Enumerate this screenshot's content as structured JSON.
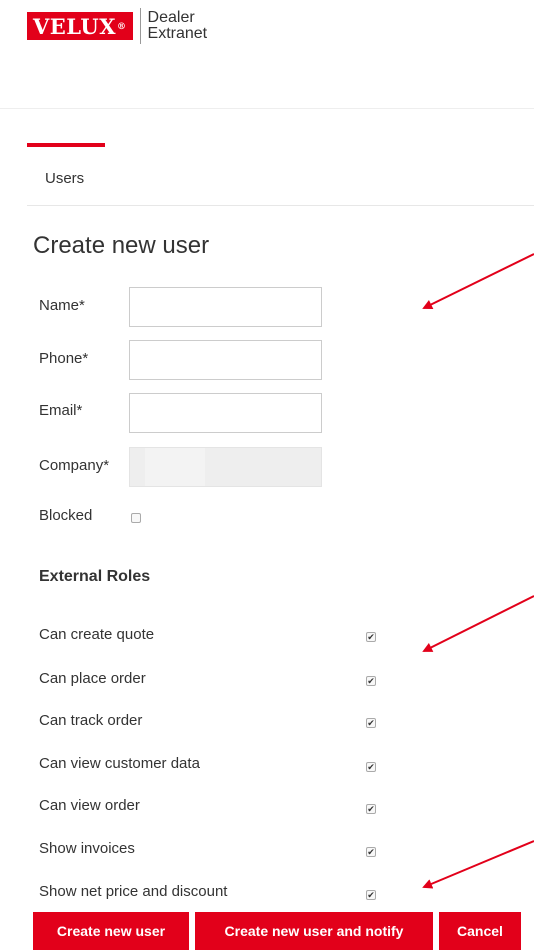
{
  "logo": {
    "brand": "VELUX",
    "reg": "®",
    "line1": "Dealer",
    "line2": "Extranet"
  },
  "tab": {
    "label": "Users"
  },
  "page_title": "Create new user",
  "form": {
    "name_label": "Name*",
    "phone_label": "Phone*",
    "email_label": "Email*",
    "company_label": "Company*",
    "blocked_label": "Blocked"
  },
  "roles": {
    "title": "External Roles",
    "items": [
      {
        "label": "Can create quote",
        "checked": true
      },
      {
        "label": "Can place order",
        "checked": true
      },
      {
        "label": "Can track order",
        "checked": true
      },
      {
        "label": "Can view customer data",
        "checked": true
      },
      {
        "label": "Can view order",
        "checked": true
      },
      {
        "label": "Show invoices",
        "checked": true
      },
      {
        "label": "Show net price and discount",
        "checked": true
      }
    ]
  },
  "buttons": {
    "create": "Create new user",
    "create_notify": "Create new user and notify",
    "cancel": "Cancel"
  },
  "colors": {
    "accent": "#e2001a"
  }
}
